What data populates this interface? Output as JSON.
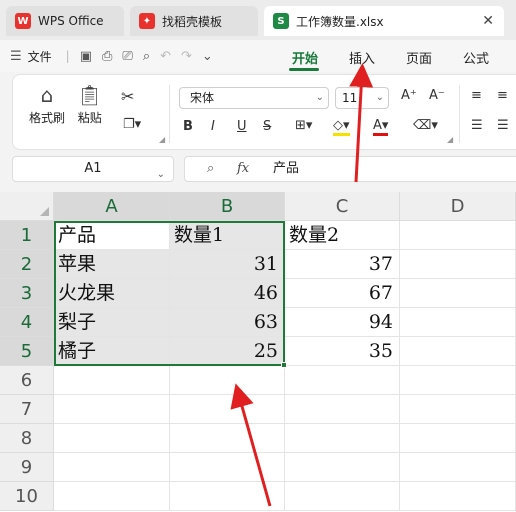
{
  "tabs": [
    {
      "label": "WPS Office",
      "icon": "wps-logo-icon"
    },
    {
      "label": "找稻壳模板",
      "icon": "docer-icon"
    },
    {
      "label": "工作簿数量.xlsx",
      "icon": "sheet-icon",
      "icon_text": "S",
      "close": "✕"
    }
  ],
  "menu": {
    "file_label": "文件",
    "tabs": [
      "开始",
      "插入",
      "页面",
      "公式"
    ],
    "active_tab": "开始"
  },
  "ribbon": {
    "format_painter": "格式刷",
    "paste": "粘贴",
    "font_name": "宋体",
    "font_size": "11"
  },
  "formula_bar": {
    "name_box": "A1",
    "fx": "fx",
    "value": "产品"
  },
  "sheet": {
    "columns": [
      "A",
      "B",
      "C",
      "D"
    ],
    "rows": [
      "1",
      "2",
      "3",
      "4",
      "5",
      "6",
      "7",
      "8",
      "9",
      "10"
    ],
    "cells": [
      [
        "产品",
        "数量1",
        "数量2"
      ],
      [
        "苹果",
        "31",
        "37"
      ],
      [
        "火龙果",
        "46",
        "67"
      ],
      [
        "梨子",
        "63",
        "94"
      ],
      [
        "橘子",
        "25",
        "35"
      ]
    ]
  },
  "colors": {
    "accent": "#1a7a3c",
    "annotation_arrow": "#e02020"
  }
}
